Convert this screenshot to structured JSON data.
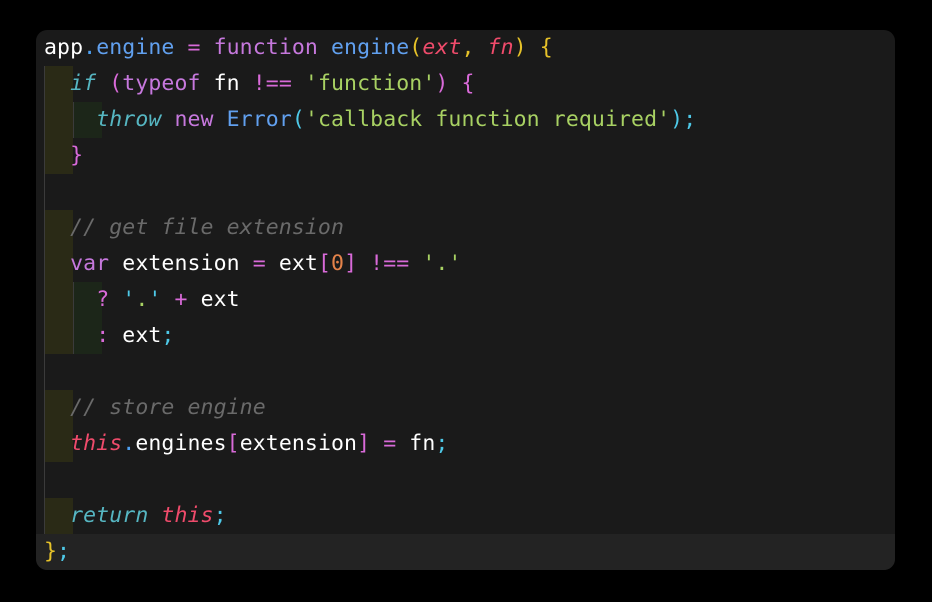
{
  "editor": {
    "language": "javascript",
    "background_color": "#1a1a1a",
    "page_background_color": "#000000",
    "current_line_highlight_color": "#232323",
    "indent_level1_color": "#2a2a16",
    "indent_level2_color": "#1c2619",
    "indent_guide_color": "#3b3b3b",
    "plain_text": "app.engine = function engine(ext, fn) {\n  if (typeof fn !== 'function') {\n    throw new Error('callback function required');\n  }\n\n  // get file extension\n  var extension = ext[0] !== '.'\n    ? '.' + ext\n    : ext;\n\n  // store engine\n  this.engines[extension] = fn;\n\n  return this;\n};"
  },
  "palette": {
    "keyword": "#c678dd",
    "control_keyword": "#56b6c2",
    "this_keyword": "#ef4b6b",
    "function_name": "#61a0ef",
    "property_dot": "#4ea1f3",
    "operator": "#d96ad9",
    "string": "#a8d163",
    "quote_mark": "#4ec9e8",
    "number": "#e5834a",
    "comment": "#6a6a6a",
    "semicolon": "#4ec9e8",
    "bracket_depth1": "#e6c229",
    "bracket_depth2": "#d96ad9",
    "bracket_depth3": "#4ec9e8",
    "identifier": "#e6e6e6"
  },
  "lines": [
    {
      "n": 1,
      "indent": 0,
      "current": false,
      "tokens": [
        {
          "text": "app",
          "cls": "t-white"
        },
        {
          "text": ".",
          "cls": "t-dot"
        },
        {
          "text": "engine",
          "cls": "t-func"
        },
        {
          "text": " ",
          "cls": "t-plain"
        },
        {
          "text": "=",
          "cls": "t-op"
        },
        {
          "text": " ",
          "cls": "t-plain"
        },
        {
          "text": "function",
          "cls": "t-keyword"
        },
        {
          "text": " ",
          "cls": "t-plain"
        },
        {
          "text": "engine",
          "cls": "t-func"
        },
        {
          "text": "(",
          "cls": "t-br-y"
        },
        {
          "text": "ext",
          "cls": "t-this"
        },
        {
          "text": ",",
          "cls": "t-br-y"
        },
        {
          "text": " ",
          "cls": "t-plain"
        },
        {
          "text": "fn",
          "cls": "t-this"
        },
        {
          "text": ")",
          "cls": "t-br-y"
        },
        {
          "text": " ",
          "cls": "t-plain"
        },
        {
          "text": "{",
          "cls": "t-br-y"
        }
      ]
    },
    {
      "n": 2,
      "indent": 1,
      "current": false,
      "tokens": [
        {
          "text": "  ",
          "cls": "t-plain"
        },
        {
          "text": "if",
          "cls": "t-control"
        },
        {
          "text": " ",
          "cls": "t-plain"
        },
        {
          "text": "(",
          "cls": "t-br-m"
        },
        {
          "text": "typeof",
          "cls": "t-keyword"
        },
        {
          "text": " ",
          "cls": "t-plain"
        },
        {
          "text": "fn",
          "cls": "t-white"
        },
        {
          "text": " ",
          "cls": "t-plain"
        },
        {
          "text": "!==",
          "cls": "t-op"
        },
        {
          "text": " ",
          "cls": "t-plain"
        },
        {
          "text": "'function'",
          "cls": "t-string"
        },
        {
          "text": ")",
          "cls": "t-br-m"
        },
        {
          "text": " ",
          "cls": "t-plain"
        },
        {
          "text": "{",
          "cls": "t-br-m"
        }
      ]
    },
    {
      "n": 3,
      "indent": 2,
      "current": false,
      "tokens": [
        {
          "text": "    ",
          "cls": "t-plain"
        },
        {
          "text": "throw",
          "cls": "t-control"
        },
        {
          "text": " ",
          "cls": "t-plain"
        },
        {
          "text": "new",
          "cls": "t-keyword"
        },
        {
          "text": " ",
          "cls": "t-plain"
        },
        {
          "text": "Error",
          "cls": "t-func"
        },
        {
          "text": "(",
          "cls": "t-br-c"
        },
        {
          "text": "'callback function required'",
          "cls": "t-string"
        },
        {
          "text": ")",
          "cls": "t-br-c"
        },
        {
          "text": ";",
          "cls": "t-semi"
        }
      ]
    },
    {
      "n": 4,
      "indent": 1,
      "current": false,
      "tokens": [
        {
          "text": "  ",
          "cls": "t-plain"
        },
        {
          "text": "}",
          "cls": "t-br-m"
        }
      ]
    },
    {
      "n": 5,
      "indent": 0,
      "current": false,
      "tokens": []
    },
    {
      "n": 6,
      "indent": 1,
      "current": false,
      "tokens": [
        {
          "text": "  ",
          "cls": "t-plain"
        },
        {
          "text": "// get file extension",
          "cls": "t-comment"
        }
      ]
    },
    {
      "n": 7,
      "indent": 1,
      "current": false,
      "tokens": [
        {
          "text": "  ",
          "cls": "t-plain"
        },
        {
          "text": "var",
          "cls": "t-keyword"
        },
        {
          "text": " ",
          "cls": "t-plain"
        },
        {
          "text": "extension",
          "cls": "t-white"
        },
        {
          "text": " ",
          "cls": "t-plain"
        },
        {
          "text": "=",
          "cls": "t-op"
        },
        {
          "text": " ",
          "cls": "t-plain"
        },
        {
          "text": "ext",
          "cls": "t-white"
        },
        {
          "text": "[",
          "cls": "t-br-m"
        },
        {
          "text": "0",
          "cls": "t-number"
        },
        {
          "text": "]",
          "cls": "t-br-m"
        },
        {
          "text": " ",
          "cls": "t-plain"
        },
        {
          "text": "!==",
          "cls": "t-op"
        },
        {
          "text": " ",
          "cls": "t-plain"
        },
        {
          "text": "'.'",
          "cls": "t-string"
        }
      ]
    },
    {
      "n": 8,
      "indent": 2,
      "current": false,
      "tokens": [
        {
          "text": "    ",
          "cls": "t-plain"
        },
        {
          "text": "?",
          "cls": "t-op"
        },
        {
          "text": " ",
          "cls": "t-plain"
        },
        {
          "text": "'",
          "cls": "t-quote"
        },
        {
          "text": ".",
          "cls": "t-string"
        },
        {
          "text": "'",
          "cls": "t-quote"
        },
        {
          "text": " ",
          "cls": "t-plain"
        },
        {
          "text": "+",
          "cls": "t-op"
        },
        {
          "text": " ",
          "cls": "t-plain"
        },
        {
          "text": "ext",
          "cls": "t-white"
        }
      ]
    },
    {
      "n": 9,
      "indent": 2,
      "current": false,
      "tokens": [
        {
          "text": "    ",
          "cls": "t-plain"
        },
        {
          "text": ":",
          "cls": "t-op"
        },
        {
          "text": " ",
          "cls": "t-plain"
        },
        {
          "text": "ext",
          "cls": "t-white"
        },
        {
          "text": ";",
          "cls": "t-semi"
        }
      ]
    },
    {
      "n": 10,
      "indent": 0,
      "current": false,
      "tokens": []
    },
    {
      "n": 11,
      "indent": 1,
      "current": false,
      "tokens": [
        {
          "text": "  ",
          "cls": "t-plain"
        },
        {
          "text": "// store engine",
          "cls": "t-comment"
        }
      ]
    },
    {
      "n": 12,
      "indent": 1,
      "current": false,
      "tokens": [
        {
          "text": "  ",
          "cls": "t-plain"
        },
        {
          "text": "this",
          "cls": "t-this"
        },
        {
          "text": ".",
          "cls": "t-dot"
        },
        {
          "text": "engines",
          "cls": "t-white"
        },
        {
          "text": "[",
          "cls": "t-br-m"
        },
        {
          "text": "extension",
          "cls": "t-white"
        },
        {
          "text": "]",
          "cls": "t-br-m"
        },
        {
          "text": " ",
          "cls": "t-plain"
        },
        {
          "text": "=",
          "cls": "t-op"
        },
        {
          "text": " ",
          "cls": "t-plain"
        },
        {
          "text": "fn",
          "cls": "t-white"
        },
        {
          "text": ";",
          "cls": "t-semi"
        }
      ]
    },
    {
      "n": 13,
      "indent": 0,
      "current": false,
      "tokens": []
    },
    {
      "n": 14,
      "indent": 1,
      "current": false,
      "tokens": [
        {
          "text": "  ",
          "cls": "t-plain"
        },
        {
          "text": "return",
          "cls": "t-control"
        },
        {
          "text": " ",
          "cls": "t-plain"
        },
        {
          "text": "this",
          "cls": "t-this"
        },
        {
          "text": ";",
          "cls": "t-semi"
        }
      ]
    },
    {
      "n": 15,
      "indent": 0,
      "current": true,
      "tokens": [
        {
          "text": "}",
          "cls": "t-br-y"
        },
        {
          "text": ";",
          "cls": "t-semi"
        }
      ]
    }
  ]
}
